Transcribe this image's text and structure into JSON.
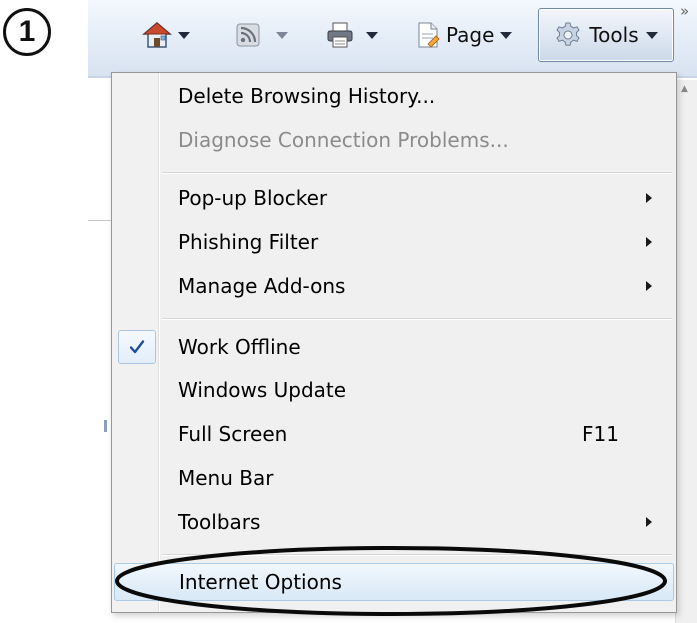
{
  "step_marker": "1",
  "toolbar": {
    "page_label": "Page",
    "tools_label": "Tools",
    "overflow": "»"
  },
  "icons": {
    "home": "home-icon",
    "feeds": "rss-feed-icon",
    "print": "printer-icon",
    "page": "page-icon",
    "tools": "gear-icon"
  },
  "menu": {
    "items": [
      {
        "label": "Delete Browsing History..."
      },
      {
        "label": "Diagnose Connection Problems...",
        "disabled": true
      },
      {
        "label": "Pop-up Blocker",
        "submenu": true
      },
      {
        "label": "Phishing Filter",
        "submenu": true
      },
      {
        "label": "Manage Add-ons",
        "submenu": true
      },
      {
        "label": "Work Offline",
        "checked": true
      },
      {
        "label": "Windows Update"
      },
      {
        "label": "Full Screen",
        "shortcut": "F11"
      },
      {
        "label": "Menu Bar"
      },
      {
        "label": "Toolbars",
        "submenu": true
      },
      {
        "label": "Internet Options",
        "highlighted": true
      }
    ]
  },
  "colors": {
    "toolbar_top": "#f4f8fd",
    "toolbar_bottom": "#d8e3f1",
    "menu_bg": "#f0f0f0",
    "disabled_text": "#8b8b8b",
    "check_color": "#1f4f9a"
  }
}
